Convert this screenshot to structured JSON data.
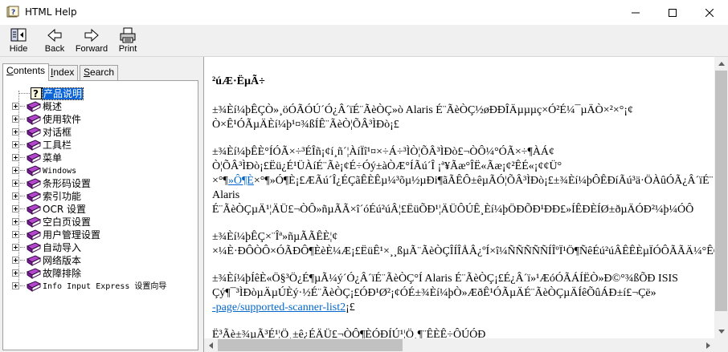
{
  "window": {
    "title": "HTML Help"
  },
  "toolbar": {
    "hide_label": "Hide",
    "back_label": "Back",
    "forward_label": "Forward",
    "print_label": "Print"
  },
  "tabs": [
    {
      "label": "Contents",
      "underline": "C",
      "rest": "ontents"
    },
    {
      "label": "Index",
      "underline": "I",
      "rest": "ndex"
    },
    {
      "label": "Search",
      "underline": "S",
      "rest": "earch"
    }
  ],
  "tree": {
    "items": [
      {
        "label": "产品说明",
        "type": "page",
        "selected": true
      },
      {
        "label": "概述",
        "type": "book"
      },
      {
        "label": "使用软件",
        "type": "book"
      },
      {
        "label": "对话框",
        "type": "book"
      },
      {
        "label": "工具栏",
        "type": "book"
      },
      {
        "label": "菜单",
        "type": "book"
      },
      {
        "label": "Windows",
        "type": "book"
      },
      {
        "label": "条形码设置",
        "type": "book"
      },
      {
        "label": "索引功能",
        "type": "book"
      },
      {
        "label": "OCR 设置",
        "type": "book"
      },
      {
        "label": "空白页设置",
        "type": "book"
      },
      {
        "label": "用户管理设置",
        "type": "book"
      },
      {
        "label": "自动导入",
        "type": "book"
      },
      {
        "label": "网络版本",
        "type": "book"
      },
      {
        "label": "故障排除",
        "type": "book"
      },
      {
        "label": "Info Input Express 设置向导",
        "type": "book"
      }
    ]
  },
  "content": {
    "heading": "²úÆ·ËµÃ÷",
    "p1": [
      "±¾Èí¼þÊÇÒ»¸öÓÃÓÚ´Ó¿Â´ïÉ¨ÃèÒÇ»ò Alaris É¨ÃèÒÇ½øÐÐÎÄµµµç×Ó²É¼¯µÄÒ×²×°¡¢",
      "Ò×Ê¹ÓÃµÄÈí¼þ¹¤¾ßÍÊ¨ÃèÒ¦ÕÂ³ÌÐò¡£"
    ],
    "p2": [
      "±¾Èí¼þÊÈ°ÍÓÃ×÷³ÉÎñ¡¢í¸ñ´¦ÀíÏî¹¤×÷Á÷³ÌÒ¦ÕÂ³ÌÐò£¬ÒÔ¼°ÓÃ×÷¶ÀÁ¢",
      "Ò¦ÕÂ³ÌÐò¡£Ëü¿É¹ÜÀíÉ¨Ãè¡¢É÷Óý±àÒÆ°ÍÃú´Î ¡ª¥Ãæ°ÎË«Ãæ¡¢²ÊÉ«¡¢¢Ü°",
      "×°¶»Ó¶È¡£ÆÃú´Î¿ÉÇãÊÈÊµ¼³õµ½µÐi¶ãÃÊÔ±êµÃÓ¦ÕÂ³ÌÐò¡£±¾Èí¼þÔÊÐíÃú³ä·ÖÀûÓÃ¿Â´ïÉ¨",
      "Alaris",
      "É¨ÃèÒÇµÄ¹¦ÄÜ£¬ÒÔ»ñµÃÃ×î´óÉú²úÂ¦£ËüÕÐ¹¦ÄÜÔÚÊ¸Èí¼þÖÐÕÐ¹ÐÐ£»ÍÊÐÈÍØ±ðµÄÓÐ²¼þ¼ÓÔ"
    ],
    "p2_link": "»Ô¶È",
    "p3": [
      "±¾Èí¼þÊÇ×¨Îª»ñµÃÃÊÈ¦¢",
      "×¼È·ÐÔÒÔ×ÓÃÐÔ¶ÈèÈ¼Æ¡£ËüÊ¹×¸¸ßµÃ¨ÃèÒÇÎÍÎÅÂ¿ºÍ×î¼ÑÑÑÑÑÍÎºÏ¹Ö¶ÑêÉú²úÂÊÊÈµÏÓÔÃÃÄ¼°ÊÇÏÈÎÆ¡¢"
    ],
    "p4": [
      "±¾Èí¼þÍêÈ«Ö§³Ö¿É¶µÃ¼ý´Ó¿Â´ïÉ¨ÃèÒÇ°Í Alaris É¨ÃèÒÇ¡£É¿Â´ï»¹ÆóÓÃÁÍËÒ»Ð©°¾ßÕÐ ISIS",
      "Çý¶¯³ÌÐòµÄµÚÈý·½É¨ÃèÒÇ¡£ÓÐ¹Ø²¡¢ÓÉ±¾Èí¼þÒ»ÆðÊ¹ÓÃµÄÉ¨ÃèÒÇµÄÍêÕûÁÐ±í£¬Çë»"
    ],
    "p4_link": "-page/supported-scanner-list2",
    "p4_tail": "¡£",
    "p5_partial": "Ë³Ãè±¾µÃ³É¹¦Ö¸±ê¿ÉÄÜ£¬ÒÔ¶ÈÓÐÍÚ¹¦Ö¸¶¨ÊÈÊ÷ÔÚÓÐ"
  }
}
